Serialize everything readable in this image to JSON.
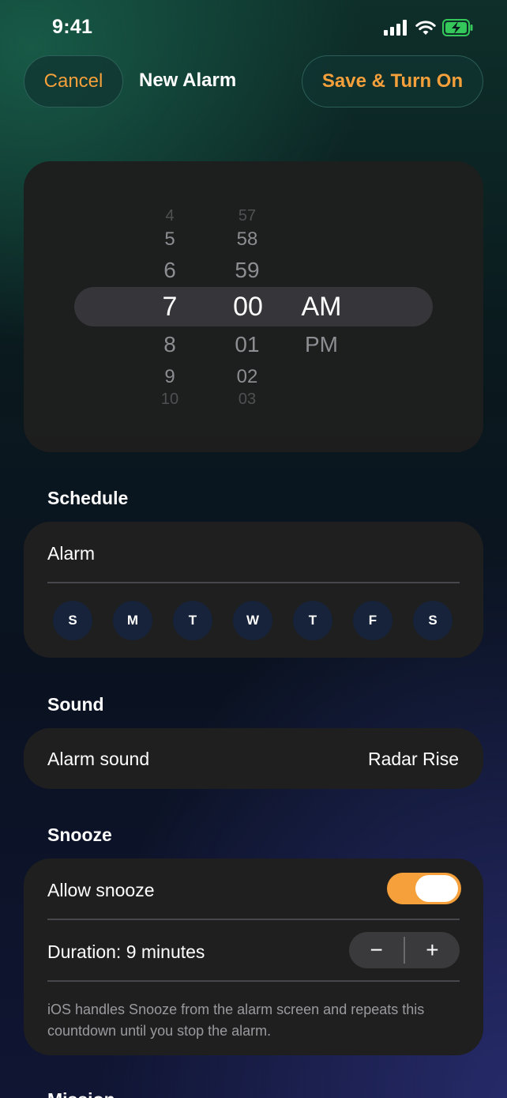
{
  "status_bar": {
    "time": "9:41"
  },
  "nav": {
    "cancel_label": "Cancel",
    "title": "New Alarm",
    "save_label": "Save & Turn On"
  },
  "time_picker": {
    "hours_above": [
      "4",
      "5",
      "6"
    ],
    "hour_selected": "7",
    "hours_below": [
      "8",
      "9",
      "10"
    ],
    "minutes_above": [
      "57",
      "58",
      "59"
    ],
    "minute_selected": "00",
    "minutes_below": [
      "01",
      "02",
      "03"
    ],
    "period_selected": "AM",
    "period_other": "PM"
  },
  "schedule": {
    "section_title": "Schedule",
    "alarm_label": "Alarm",
    "days": [
      "S",
      "M",
      "T",
      "W",
      "T",
      "F",
      "S"
    ]
  },
  "sound": {
    "section_title": "Sound",
    "row_label": "Alarm sound",
    "row_value": "Radar Rise"
  },
  "snooze": {
    "section_title": "Snooze",
    "allow_label": "Allow snooze",
    "allow_enabled": true,
    "duration_label": "Duration: 9 minutes",
    "minus_label": "−",
    "plus_label": "+",
    "footnote": "iOS handles Snooze from the alarm screen and repeats this countdown until you stop the alarm."
  },
  "next_section": {
    "section_title": "Mission"
  },
  "colors": {
    "accent": "#f5a03b",
    "card": "#1f1f1f",
    "day_circle": "#16233a",
    "battery": "#34c759"
  }
}
